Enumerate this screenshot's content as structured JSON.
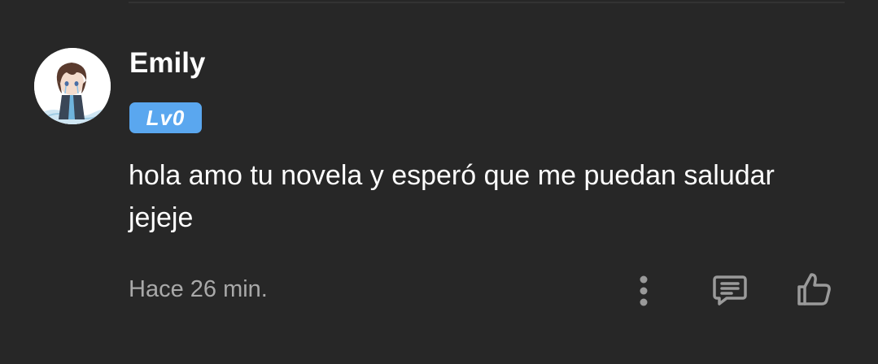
{
  "comment": {
    "username": "Emily",
    "level_badge": "Lv0",
    "text": "hola amo tu novela y esperó que me puedan saludar jejeje",
    "timestamp": "Hace 26 min."
  },
  "icons": {
    "more": "more-vertical-icon",
    "reply": "comment-reply-icon",
    "like": "thumbs-up-icon"
  },
  "colors": {
    "background": "#272727",
    "badge": "#5aa7ef",
    "muted_text": "#a9a9a9",
    "icon": "#9a9a9a"
  }
}
